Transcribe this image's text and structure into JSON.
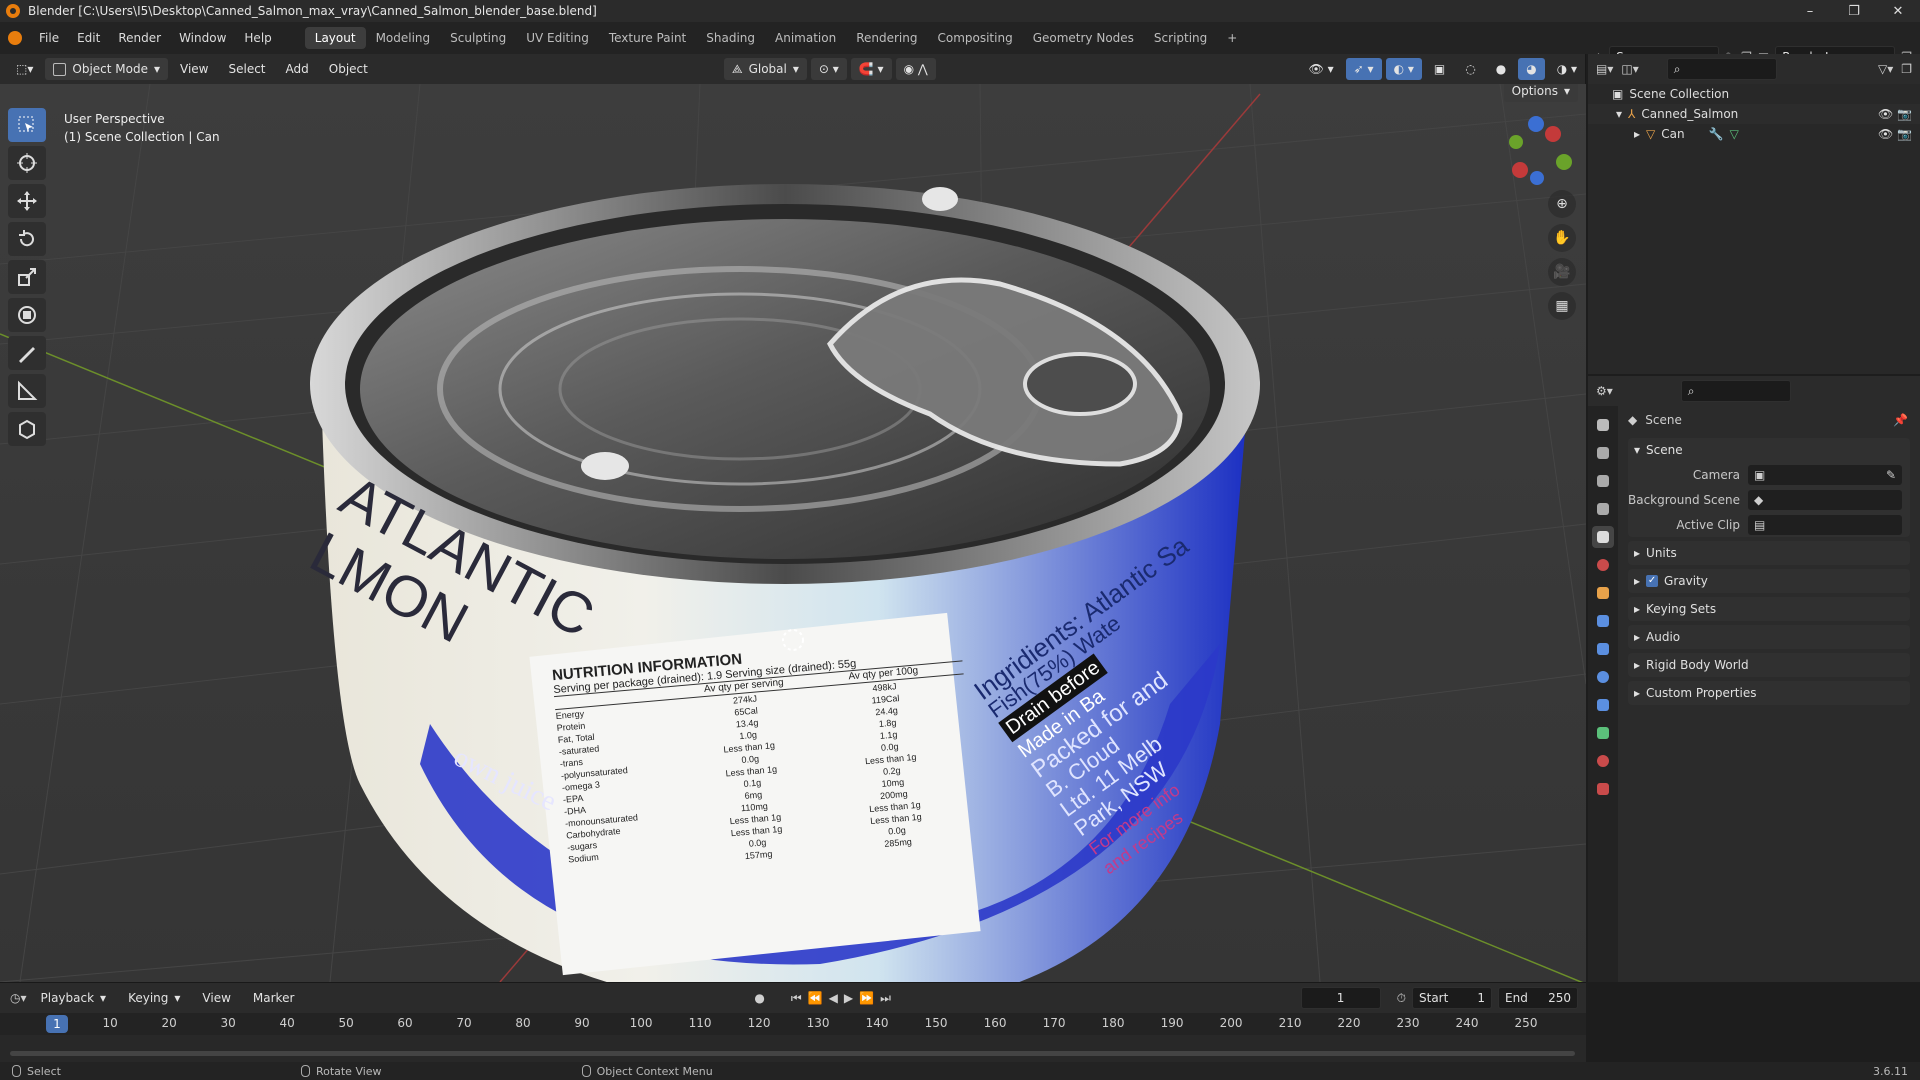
{
  "window": {
    "title": "Blender [C:\\Users\\I5\\Desktop\\Canned_Salmon_max_vray\\Canned_Salmon_blender_base.blend]",
    "controls": [
      "–",
      "❐",
      "✕"
    ]
  },
  "menu": {
    "items": [
      "File",
      "Edit",
      "Render",
      "Window",
      "Help"
    ],
    "workspaces": [
      "Layout",
      "Modeling",
      "Sculpting",
      "UV Editing",
      "Texture Paint",
      "Shading",
      "Animation",
      "Rendering",
      "Compositing",
      "Geometry Nodes",
      "Scripting",
      "+"
    ],
    "active_workspace": "Layout",
    "scene_name": "Scene",
    "view_layer": "RenderLayer"
  },
  "viewport_header": {
    "mode": "Object Mode",
    "menus": [
      "View",
      "Select",
      "Add",
      "Object"
    ],
    "orientation": "Global",
    "options_label": "Options"
  },
  "viewport": {
    "perspective_label": "User Perspective",
    "collection_label": "(1) Scene Collection | Can",
    "can_label": {
      "brand_line1": "ATLANTIC",
      "brand_line2": "LMON",
      "band_text": "own juice",
      "nutrition_title": "NUTRITION INFORMATION",
      "serving_line": "Serving per package (drained): 1.9 Serving size (drained): 55g",
      "col_headers": [
        "Av qty per serving",
        "Av qty per 100g"
      ],
      "rows": [
        [
          "Energy",
          "274kJ",
          "498kJ"
        ],
        [
          "Protein",
          "65Cal",
          "119Cal"
        ],
        [
          "Fat, Total",
          "13.4g",
          "24.4g"
        ],
        [
          "-saturated",
          "1.0g",
          "1.8g"
        ],
        [
          "-trans",
          "Less than 1g",
          "1.1g"
        ],
        [
          "-polyunsaturated",
          "0.0g",
          "0.0g"
        ],
        [
          "-omega 3",
          "Less than 1g",
          "Less than 1g"
        ],
        [
          "-EPA",
          "0.1g",
          "0.2g"
        ],
        [
          "-DHA",
          "6mg",
          "10mg"
        ],
        [
          "-monounsaturated",
          "110mg",
          "200mg"
        ],
        [
          "Carbohydrate",
          "Less than 1g",
          "Less than 1g"
        ],
        [
          "-sugars",
          "Less than 1g",
          "Less than 1g"
        ],
        [
          "Sodium",
          "0.0g",
          "0.0g"
        ],
        [
          "",
          "157mg",
          "285mg"
        ]
      ],
      "ingredients": "Ingridients: Atlantic Sa",
      "ingredients2": "Fish(75%) Wate",
      "drain": "Drain before",
      "made_in": "Made in Ba",
      "packed": "Packed for and",
      "company1": "B. Cloud",
      "company2": "Ltd. 11 Melb",
      "company3": "Park, NSW",
      "more_info": "For more info",
      "visit": "and recipes"
    }
  },
  "outliner": {
    "scene_collection": "Scene Collection",
    "collection": "Canned_Salmon",
    "object": "Can"
  },
  "properties": {
    "header": "Scene",
    "panel_scene": "Scene",
    "camera_label": "Camera",
    "background_label": "Background Scene",
    "active_clip_label": "Active Clip",
    "sections": [
      "Units",
      "Gravity",
      "Keying Sets",
      "Audio",
      "Rigid Body World",
      "Custom Properties"
    ],
    "gravity_checked": true
  },
  "timeline": {
    "menus": [
      "Playback",
      "Keying",
      "View",
      "Marker"
    ],
    "current_frame": "1",
    "start_label": "Start",
    "start_value": "1",
    "end_label": "End",
    "end_value": "250",
    "ticks": [
      "1",
      "10",
      "20",
      "30",
      "40",
      "50",
      "60",
      "70",
      "80",
      "90",
      "100",
      "110",
      "120",
      "130",
      "140",
      "150",
      "160",
      "170",
      "180",
      "190",
      "200",
      "210",
      "220",
      "230",
      "240",
      "250"
    ]
  },
  "statusbar": {
    "select": "Select",
    "rotate": "Rotate View",
    "context": "Object Context Menu",
    "version": "3.6.11"
  },
  "colors": {
    "accent": "#4772b3",
    "blender_orange": "#e87d0d",
    "grid_bg": "#393939",
    "axis_red": "#9b3a3a",
    "axis_green": "#6c8f2a"
  }
}
